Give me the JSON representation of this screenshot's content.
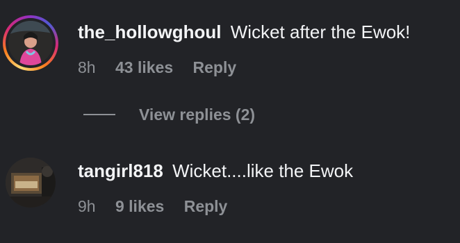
{
  "comments": [
    {
      "username": "the_hollowghoul",
      "text": "Wicket after the Ewok!",
      "time": "8h",
      "likes": "43 likes",
      "reply": "Reply",
      "has_story_ring": true
    },
    {
      "username": "tangirl818",
      "text": "Wicket....like the Ewok",
      "time": "9h",
      "likes": "9 likes",
      "reply": "Reply",
      "has_story_ring": false
    }
  ],
  "view_replies": {
    "label": "View replies (2)"
  },
  "colors": {
    "background": "#222327",
    "primary_text": "#f3f4f6",
    "secondary_text": "#8e9196"
  }
}
